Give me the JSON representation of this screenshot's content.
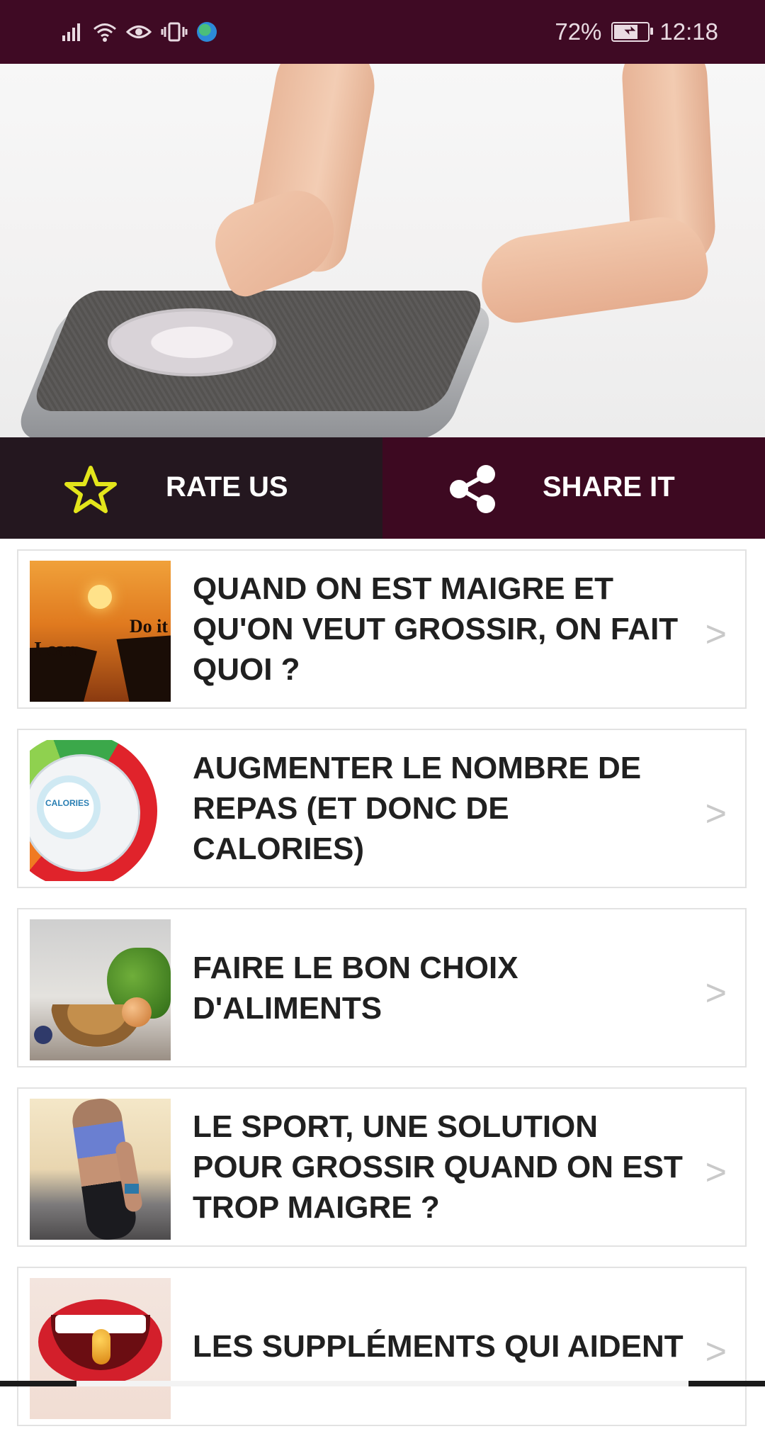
{
  "status_bar": {
    "battery_text": "72%",
    "battery_level": 0.72,
    "time": "12:18",
    "icons": [
      "signal-icon",
      "wifi-icon",
      "eye-icon",
      "vibrate-icon",
      "globe-icon",
      "battery-icon"
    ]
  },
  "hero": {
    "image_name": "feet-on-bathroom-scale"
  },
  "actions": {
    "rate_label": "RATE US",
    "share_label": "SHARE IT",
    "rate_icon": "star-icon",
    "share_icon": "share-icon",
    "star_color": "#e3e51b"
  },
  "articles": [
    {
      "title": "QUAND ON EST MAIGRE ET QU'ON VEUT GROSSIR, ON FAIT QUOI ?",
      "thumb_text_left": "I can",
      "thumb_text_right": "Do it"
    },
    {
      "title": "AUGMENTER LE NOMBRE DE REPAS (ET DONC DE CALORIES)",
      "thumb_text": "CALORIES"
    },
    {
      "title": "FAIRE LE BON CHOIX D'ALIMENTS"
    },
    {
      "title": "LE SPORT, UNE SOLUTION POUR GROSSIR QUAND ON EST TROP MAIGRE ?"
    },
    {
      "title": "LES SUPPLÉMENTS QUI AIDENT"
    }
  ],
  "list_chevron": ">",
  "colors": {
    "status_bar": "#3f0a24",
    "rate_bg": "#24171f",
    "share_bg": "#3d0921",
    "title_text": "#202020"
  }
}
